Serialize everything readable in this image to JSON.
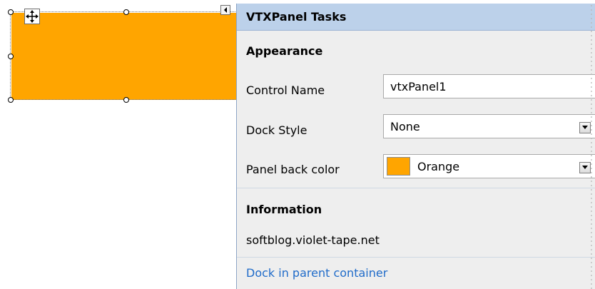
{
  "task_panel": {
    "title": "VTXPanel Tasks",
    "appearance_header": "Appearance",
    "control_name_label": "Control Name",
    "control_name_value": "vtxPanel1",
    "dock_style_label": "Dock Style",
    "dock_style_value": "None",
    "back_color_label": "Panel back color",
    "back_color_value": "Orange",
    "back_color_hex": "#FFA500",
    "information_header": "Information",
    "info_text": "softblog.violet-tape.net",
    "dock_link": "Dock in parent container"
  },
  "designer": {
    "panel_color": "#FFA500",
    "move_icon": "move-icon",
    "smart_tag_icon": "smart-tag-arrow-icon"
  },
  "colors": {
    "header_bg": "#bcd1ea",
    "panel_bg": "#eeeeee",
    "link": "#1f6bc9"
  }
}
